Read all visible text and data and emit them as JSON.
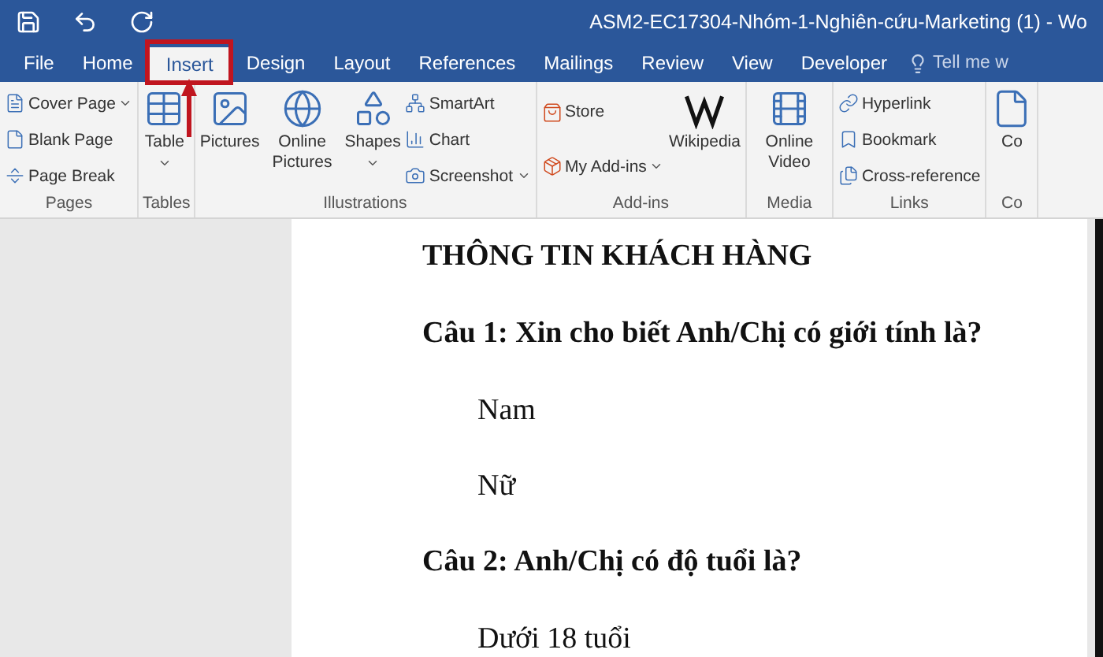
{
  "title_bar": {
    "title": "ASM2-EC17304-Nhóm-1-Nghiên-cứu-Marketing (1) - Wo"
  },
  "tabs": [
    {
      "label": "File",
      "selected": false
    },
    {
      "label": "Home",
      "selected": false
    },
    {
      "label": "Insert",
      "selected": true
    },
    {
      "label": "Design",
      "selected": false
    },
    {
      "label": "Layout",
      "selected": false
    },
    {
      "label": "References",
      "selected": false
    },
    {
      "label": "Mailings",
      "selected": false
    },
    {
      "label": "Review",
      "selected": false
    },
    {
      "label": "View",
      "selected": false
    },
    {
      "label": "Developer",
      "selected": false
    }
  ],
  "tell_me": "Tell me w",
  "ribbon_groups": [
    {
      "label": "Pages",
      "items": [
        {
          "kind": "small",
          "label": "Cover Page",
          "dropdown": true
        },
        {
          "kind": "small",
          "label": "Blank Page",
          "dropdown": false
        },
        {
          "kind": "small",
          "label": "Page Break",
          "dropdown": false
        }
      ]
    },
    {
      "label": "Tables",
      "items": [
        {
          "kind": "large",
          "label": "Table",
          "dropdown": true
        }
      ]
    },
    {
      "label": "Illustrations",
      "items": [
        {
          "kind": "large",
          "label": "Pictures",
          "dropdown": false
        },
        {
          "kind": "large",
          "label": "Online Pictures",
          "dropdown": false
        },
        {
          "kind": "large",
          "label": "Shapes",
          "dropdown": true
        },
        {
          "kind": "small",
          "label": "SmartArt",
          "dropdown": false
        },
        {
          "kind": "small",
          "label": "Chart",
          "dropdown": false
        },
        {
          "kind": "small",
          "label": "Screenshot",
          "dropdown": true
        }
      ]
    },
    {
      "label": "Add-ins",
      "items": [
        {
          "kind": "small",
          "label": "Store",
          "dropdown": false
        },
        {
          "kind": "small",
          "label": "My Add-ins",
          "dropdown": true
        },
        {
          "kind": "large",
          "label": "Wikipedia",
          "dropdown": false
        }
      ]
    },
    {
      "label": "Media",
      "items": [
        {
          "kind": "large",
          "label": "Online Video",
          "dropdown": false
        }
      ]
    },
    {
      "label": "Links",
      "items": [
        {
          "kind": "small",
          "label": "Hyperlink",
          "dropdown": false
        },
        {
          "kind": "small",
          "label": "Bookmark",
          "dropdown": false
        },
        {
          "kind": "small",
          "label": "Cross-reference",
          "dropdown": false
        }
      ]
    },
    {
      "label": "Co",
      "items": [
        {
          "kind": "large",
          "label": "Co",
          "dropdown": false
        }
      ]
    }
  ],
  "document": [
    {
      "kind": "heading",
      "text": "THÔNG TIN KHÁCH HÀNG"
    },
    {
      "kind": "question",
      "text": "Câu 1: Xin cho biết Anh/Chị có giới tính là?"
    },
    {
      "kind": "option",
      "text": "Nam"
    },
    {
      "kind": "option",
      "text": "Nữ"
    },
    {
      "kind": "question",
      "text": "Câu 2: Anh/Chị có độ tuổi là?"
    },
    {
      "kind": "option",
      "text": "Dưới 18 tuổi"
    }
  ]
}
